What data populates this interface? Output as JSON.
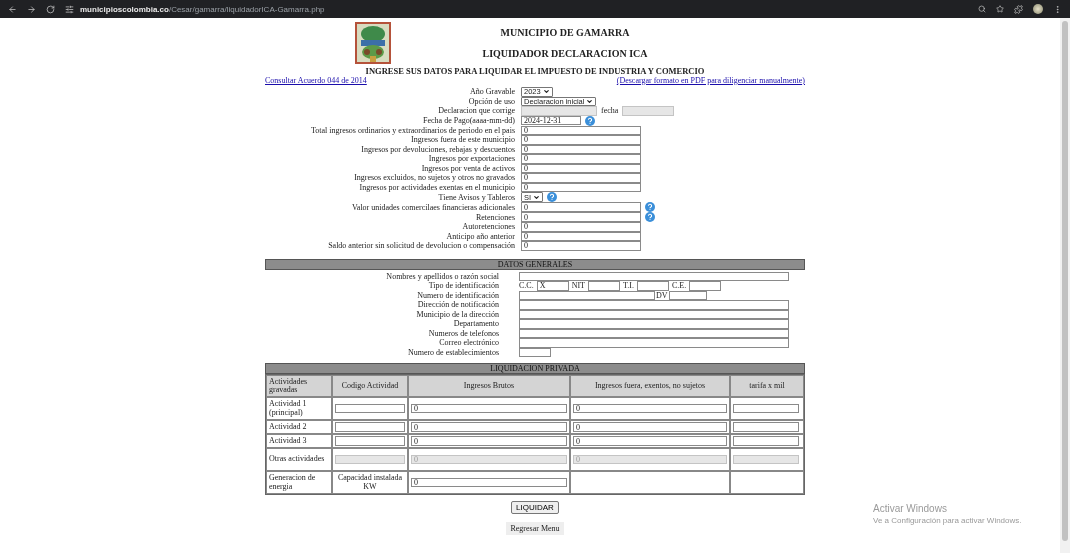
{
  "browser": {
    "url_host": "municipioscolombia.co",
    "url_path": "/Cesar/gamarra/liquidadorICA-Gamarra.php"
  },
  "header": {
    "title": "MUNICIPIO DE GAMARRA",
    "subtitle": "LIQUIDADOR DECLARACION ICA",
    "headline": "INGRESE SUS DATOS PARA LIQUIDAR EL IMPUESTO DE INDUSTRIA Y COMERCIO",
    "links": [
      "Consultar Acuerdo 044 de 2014",
      "(Descargar formato en PDF para diligenciar manualmente)"
    ]
  },
  "tax_form": [
    {
      "kind": "select",
      "label": "Año Gravable",
      "value": "2023",
      "help": false
    },
    {
      "kind": "select",
      "label": "Opción de uso",
      "value": "Declaracion inicial",
      "help": false
    },
    {
      "kind": "correction",
      "label": "Declaracion que corrige",
      "date_label": "fecha",
      "help": false
    },
    {
      "kind": "date",
      "label": "Fecha de Pago(aaaa-mm-dd)",
      "value": "2024-12-31",
      "help": true
    },
    {
      "kind": "text",
      "label": "Total ingresos ordinarios y extraordinarios de periodo en el pais",
      "value": "0",
      "help": false
    },
    {
      "kind": "text",
      "label": "Ingresos fuera de este municipio",
      "value": "0",
      "help": false
    },
    {
      "kind": "text",
      "label": "Ingresos por devoluciones, rebajas y descuentos",
      "value": "0",
      "help": false
    },
    {
      "kind": "text",
      "label": "Ingresos por exportaciones",
      "value": "0",
      "help": false
    },
    {
      "kind": "text",
      "label": "Ingresos por venta de activos",
      "value": "0",
      "help": false
    },
    {
      "kind": "text",
      "label": "Ingresos excluidos, no sujetos y otros no gravados",
      "value": "0",
      "help": false
    },
    {
      "kind": "text",
      "label": "Ingresos por actividades exentas en el municipio",
      "value": "0",
      "help": false
    },
    {
      "kind": "select",
      "label": "Tiene Avisos y Tableros",
      "value": "SI",
      "help": true
    },
    {
      "kind": "text",
      "label": "Valor unidades comercilaes financieras adicionales",
      "value": "0",
      "help": true
    },
    {
      "kind": "text",
      "label": "Retenciones",
      "value": "0",
      "help": true
    },
    {
      "kind": "text",
      "label": "Autoretenciones",
      "value": "0",
      "help": false
    },
    {
      "kind": "text",
      "label": "Anticipo año anterior",
      "value": "0",
      "help": false
    },
    {
      "kind": "text",
      "label": "Saldo anterior sin solicitud de devolucion o compensación",
      "value": "0",
      "help": false
    }
  ],
  "general_data": {
    "title": "DATOS GENERALES",
    "rows": [
      {
        "kind": "text",
        "label": "Nombres y apellidos o razón social"
      },
      {
        "kind": "id_type",
        "label": "Tipo de identificación",
        "options": [
          {
            "label": "C.C.",
            "value": "X"
          },
          {
            "label": "NIT"
          },
          {
            "label": "T.I."
          },
          {
            "label": "C.E."
          }
        ]
      },
      {
        "kind": "id_number",
        "label": "Numero de identificación",
        "dv_label": "DV"
      },
      {
        "kind": "text",
        "label": "Dirección de notificación"
      },
      {
        "kind": "text",
        "label": "Municipio de la dirección"
      },
      {
        "kind": "text",
        "label": "Departamento"
      },
      {
        "kind": "text",
        "label": "Numeros de telefonos"
      },
      {
        "kind": "text",
        "label": "Correo electrónico"
      },
      {
        "kind": "short",
        "label": "Numero de establecimientos"
      }
    ]
  },
  "liquidation": {
    "title": "LIQUIDACION PRIVADA",
    "columns": [
      "Actividades gravadas",
      "Codigo Actividad",
      "Ingresos Brutos",
      "Ingresos fuera, exentos, no sujetos",
      "tarifa x mil"
    ],
    "rows": [
      {
        "kind": "activity",
        "label": "Actividad 1 (principal)",
        "gross": "0",
        "excluded": "0",
        "disabled": false
      },
      {
        "kind": "activity",
        "label": "Actividad 2",
        "gross": "0",
        "excluded": "0",
        "disabled": false
      },
      {
        "kind": "activity",
        "label": "Actividad 3",
        "gross": "0",
        "excluded": "0",
        "disabled": false
      },
      {
        "kind": "activity",
        "label": "Otras actividades",
        "gross": "0",
        "excluded": "0",
        "disabled": true
      },
      {
        "kind": "energy",
        "label": "Generacion de energia",
        "sublabel": "Capacidad instalada KW",
        "gross": "0"
      }
    ]
  },
  "actions": {
    "submit": "LIQUIDAR",
    "back": "Regresar Menu"
  },
  "windows_notice": {
    "title": "Activar Windows",
    "message": "Ve a Configuración para activar Windows."
  }
}
